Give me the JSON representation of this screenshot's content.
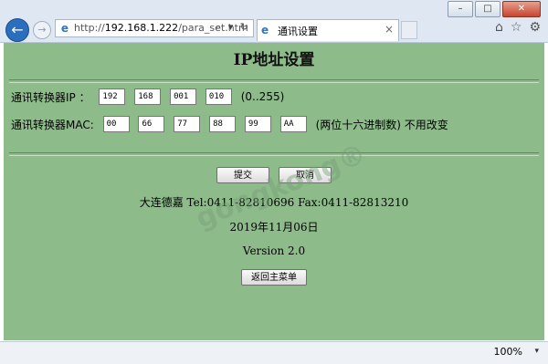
{
  "browser": {
    "url_prefix": "http://",
    "url_host": "192.168.1.222",
    "url_path": "/para_set.htm",
    "url_tools": "⌕ ▾ ↻",
    "tab_title": "通讯设置",
    "tab_close": "×",
    "back_icon": "←",
    "forward_icon": "→",
    "ie_icon": "e",
    "right_icons": {
      "home": "⌂",
      "favorites": "☆",
      "settings": "⚙"
    },
    "window_buttons": {
      "minimize": "–",
      "maximize": "□",
      "close": "✕"
    }
  },
  "page": {
    "title": "IP地址设置",
    "ip": {
      "label": "通讯转换器IP ：",
      "octets": [
        "192",
        "168",
        "001",
        "010"
      ],
      "hint": "(0..255)"
    },
    "mac": {
      "label": "通讯转换器MAC:",
      "bytes": [
        "00",
        "66",
        "77",
        "88",
        "99",
        "AA"
      ],
      "hint": "(两位十六进制数) 不用改变"
    },
    "submit_label": "提交",
    "cancel_label": "取消",
    "company": "大连德嘉 Tel:0411-82810696 Fax:0411-82813210",
    "date": "2019年11月06日",
    "version": "Version 2.0",
    "back_menu_label": "返回主菜单",
    "watermark": "gongkong®"
  },
  "status": {
    "zoom": "100%",
    "zoom_arrow": "▾"
  }
}
